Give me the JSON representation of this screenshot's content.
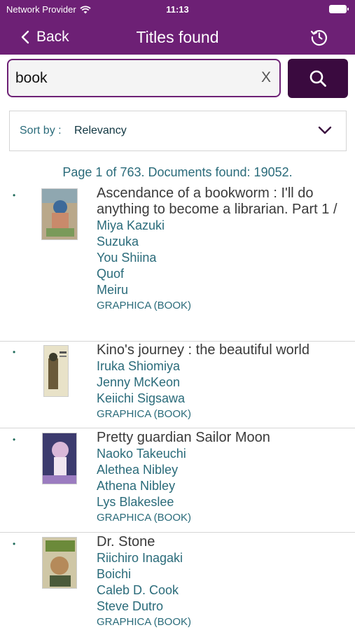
{
  "status_bar": {
    "carrier": "Network Provider",
    "time": "11:13"
  },
  "nav": {
    "back_label": "Back",
    "title": "Titles found"
  },
  "search": {
    "query": "book",
    "clear_label": "X"
  },
  "sort": {
    "label": "Sort by :",
    "value": "Relevancy"
  },
  "page_info": "Page 1 of 763. Documents found: 19052.",
  "results": [
    {
      "bullet": "•",
      "title": "Ascendance of a bookworm : I'll do anything to become a librarian. Part 1 /",
      "authors": [
        "Miya Kazuki",
        "Suzuka",
        "You Shiina",
        "Quof",
        "Meiru"
      ],
      "format": "GRAPHICA (BOOK)"
    },
    {
      "bullet": "•",
      "title": "Kino's journey : the beautiful world",
      "authors": [
        "Iruka Shiomiya",
        "Jenny McKeon",
        "Keiichi Sigsawa"
      ],
      "format": "GRAPHICA (BOOK)"
    },
    {
      "bullet": "•",
      "title": "Pretty guardian Sailor Moon",
      "authors": [
        "Naoko Takeuchi",
        "Alethea Nibley",
        "Athena Nibley",
        "Lys Blakeslee"
      ],
      "format": "GRAPHICA (BOOK)"
    },
    {
      "bullet": "•",
      "title": "Dr. Stone",
      "authors": [
        "Riichiro Inagaki",
        "Boichi",
        "Caleb D. Cook",
        "Steve Dutro"
      ],
      "format": "GRAPHICA (BOOK)"
    }
  ],
  "colors": {
    "header_bg": "#6d2075",
    "search_button_bg": "#3a0a3f",
    "link_text": "#2a6b7a"
  },
  "icons": {
    "back": "chevron-left-icon",
    "history": "history-clock-icon",
    "search": "search-icon",
    "sort": "chevron-down-icon",
    "wifi": "wifi-icon",
    "battery": "battery-icon"
  }
}
